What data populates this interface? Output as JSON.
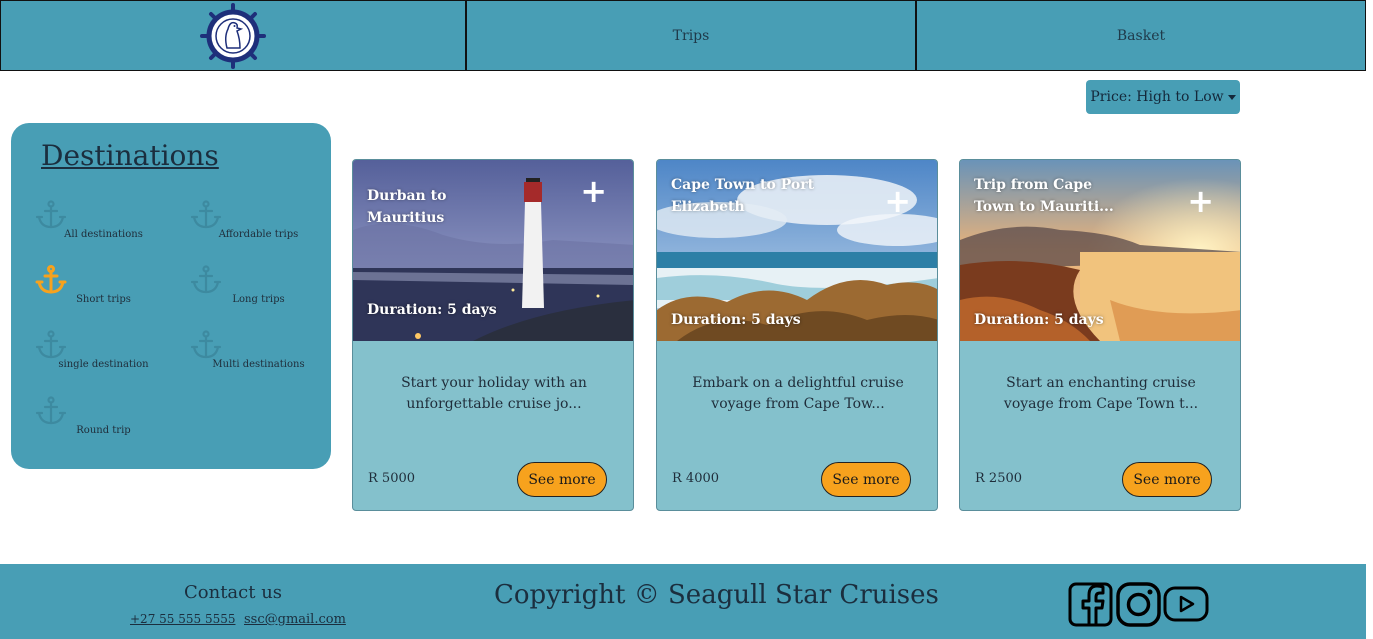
{
  "nav": {
    "items": [
      {
        "label": "Trips"
      },
      {
        "label": "Basket"
      }
    ]
  },
  "sort": {
    "label": "Price: High to Low"
  },
  "sidebar": {
    "title": "Destinations",
    "categories": [
      {
        "label": "All destinations",
        "active": false
      },
      {
        "label": "Affordable trips",
        "active": false
      },
      {
        "label": "Short trips",
        "active": true
      },
      {
        "label": "Long trips",
        "active": false
      },
      {
        "label": "single destination",
        "active": false
      },
      {
        "label": "Multi destinations",
        "active": false
      },
      {
        "label": "Round trip",
        "active": false
      }
    ]
  },
  "cards": [
    {
      "title": "Durban to Mauritius",
      "duration": "Duration: 5 days",
      "description": "Start your holiday with an unforgettable cruise jo...",
      "price": "R 5000",
      "button": "See more"
    },
    {
      "title": "Cape Town to Port Elizabeth",
      "duration": "Duration: 5 days",
      "description": "Embark on a delightful cruise voyage from Cape Tow...",
      "price": "R 4000",
      "button": "See more"
    },
    {
      "title": "Trip from Cape Town to Mauriti...",
      "duration": "Duration: 5 days",
      "description": "Start an enchanting cruise voyage from Cape Town t...",
      "price": "R 2500",
      "button": "See more"
    }
  ],
  "footer": {
    "contact_title": "Contact us",
    "phone": "+27 55 555 5555",
    "email": "ssc@gmail.com",
    "copyright": "Copyright © Seagull Star Cruises",
    "social_icons": [
      "facebook-icon",
      "instagram-icon",
      "youtube-icon"
    ]
  },
  "colors": {
    "primary": "#489eb5",
    "card_bg": "#84c1cc",
    "accent": "#f7a21d"
  }
}
